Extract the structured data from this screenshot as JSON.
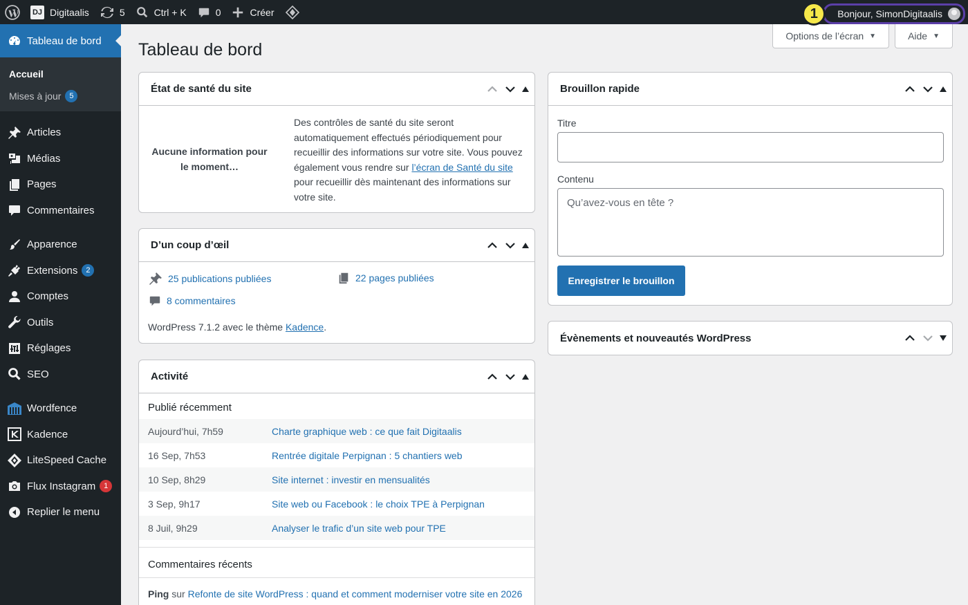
{
  "adminbar": {
    "site_name": "Digitaalis",
    "site_logo_text": "DJ",
    "updates_count": "5",
    "search_shortcut": "Ctrl + K",
    "comments_count": "0",
    "new_label": "Créer",
    "step_badge": "1",
    "howdy": "Bonjour, SimonDigitaalis"
  },
  "sidebar": {
    "current": "Tableau de bord",
    "submenu": [
      {
        "label": "Accueil"
      },
      {
        "label": "Mises à jour",
        "count": "5"
      }
    ],
    "items": [
      {
        "label": "Articles",
        "icon": "pin-icon"
      },
      {
        "label": "Médias",
        "icon": "media-icon"
      },
      {
        "label": "Pages",
        "icon": "pages-icon"
      },
      {
        "label": "Commentaires",
        "icon": "comment-icon"
      },
      {
        "label": "Apparence",
        "icon": "brush-icon"
      },
      {
        "label": "Extensions",
        "icon": "plugin-icon",
        "count": "2"
      },
      {
        "label": "Comptes",
        "icon": "user-icon"
      },
      {
        "label": "Outils",
        "icon": "wrench-icon"
      },
      {
        "label": "Réglages",
        "icon": "settings-icon"
      },
      {
        "label": "SEO",
        "icon": "search-icon"
      },
      {
        "label": "Wordfence",
        "icon": "wordfence-icon"
      },
      {
        "label": "Kadence",
        "icon": "kadence-icon"
      },
      {
        "label": "LiteSpeed Cache",
        "icon": "litespeed-icon"
      },
      {
        "label": "Flux Instagram",
        "icon": "camera-icon",
        "count": "1"
      },
      {
        "label": "Replier le menu",
        "icon": "collapse-icon"
      }
    ]
  },
  "header": {
    "screen_options": "Options de l’écran",
    "help": "Aide",
    "title": "Tableau de bord"
  },
  "health": {
    "title": "État de santé du site",
    "empty": "Aucune information pour le moment…",
    "text_before": "Des contrôles de santé du site seront automatiquement effectués périodiquement pour recueillir des informations sur votre site. Vous pouvez également vous rendre sur ",
    "link": "l’écran de Santé du site",
    "text_after": " pour recueillir dès maintenant des informations sur votre site."
  },
  "glance": {
    "title": "D’un coup d’œil",
    "posts": "25 publications publiées",
    "pages": "22 pages publiées",
    "comments": "8 commentaires",
    "footer_before": "WordPress 7.1.2 avec le thème ",
    "theme": "Kadence",
    "footer_after": "."
  },
  "activity": {
    "title": "Activité",
    "recent_title": "Publié récemment",
    "rows": [
      {
        "date": "Aujourd’hui, 7h59",
        "title": "Charte graphique web : ce que fait Digitaalis"
      },
      {
        "date": "16 Sep, 7h53",
        "title": "Rentrée digitale Perpignan : 5 chantiers web"
      },
      {
        "date": "10 Sep, 8h29",
        "title": "Site internet : investir en mensualités"
      },
      {
        "date": "3 Sep, 9h17",
        "title": "Site web ou Facebook : le choix TPE à Perpignan"
      },
      {
        "date": "8 Juil, 9h29",
        "title": "Analyser le trafic d’un site web pour TPE"
      }
    ],
    "comments_title": "Commentaires récents",
    "comment_type": "Ping",
    "comment_on": " sur ",
    "comment_post": "Refonte de site WordPress : quand et comment moderniser votre site en 2026"
  },
  "quick_draft": {
    "title": "Brouillon rapide",
    "title_label": "Titre",
    "title_value": "",
    "content_label": "Contenu",
    "content_placeholder": "Qu’avez-vous en tête ?",
    "save": "Enregistrer le brouillon"
  },
  "events": {
    "title": "Évènements et nouveautés WordPress"
  },
  "colors": {
    "accent": "#2271b1",
    "adminbar": "#1d2327",
    "badge_red": "#d63638",
    "step_badge": "#f6e84a"
  }
}
